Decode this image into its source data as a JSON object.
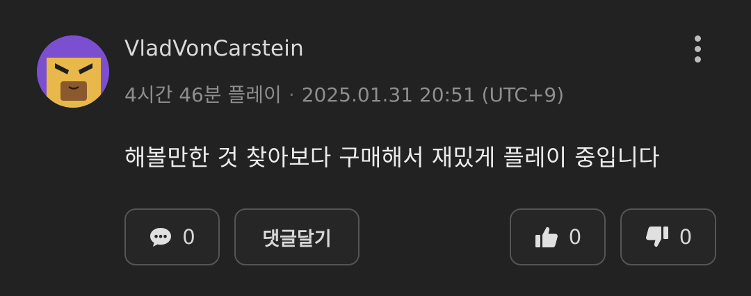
{
  "comment": {
    "username": "VladVonCarstein",
    "playtime": "4시간 46분 플레이",
    "separator": "·",
    "timestamp": "2025.01.31 20:51 (UTC+9)",
    "body": "해볼만한 것 찾아보다 구매해서 재밌게 플레이 중입니다"
  },
  "actions": {
    "comment_count": "0",
    "reply_label": "댓글달기",
    "like_count": "0",
    "dislike_count": "0"
  },
  "icons": {
    "more": "more-vertical-icon",
    "comment": "speech-bubble-icon",
    "like": "thumbs-up-icon",
    "dislike": "thumbs-down-icon"
  },
  "colors": {
    "background": "#222222",
    "avatar_bg": "#7b4fd0",
    "avatar_face": "#e8b94a",
    "button_border": "#555555",
    "muted_text": "#8e8e8e"
  }
}
